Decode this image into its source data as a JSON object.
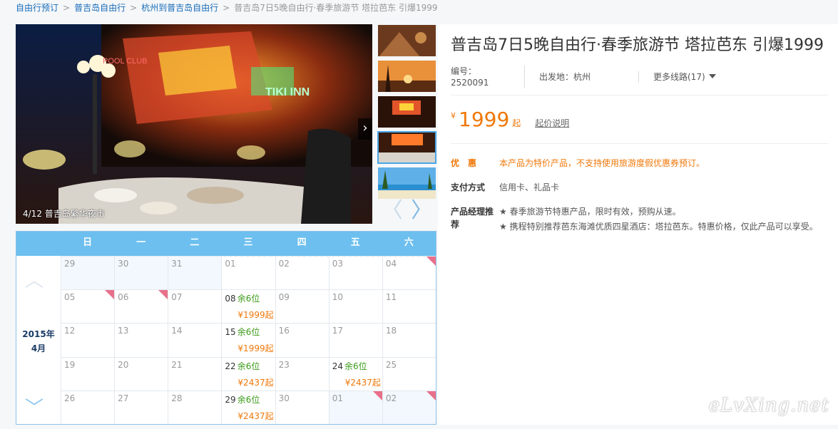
{
  "breadcrumb": {
    "items": [
      "自由行预订",
      "普吉岛自由行",
      "杭州到普吉岛自由行"
    ],
    "separator": ">",
    "current": "普吉岛7日5晚自由行·春季旅游节 塔拉芭东 引爆1999"
  },
  "gallery": {
    "caption": "4/12 普吉岛繁华夜市",
    "next_icon": "›",
    "prev_icon": "‹",
    "thumb_prev_icon": "〈",
    "thumb_next_icon": "〉",
    "photo_sign_1": "POOL CLUB",
    "photo_sign_2": "TIKI INN"
  },
  "calendar": {
    "year_month": "2015年",
    "month": "4月",
    "up_icon": "︿",
    "down_icon": "﹀",
    "weekdays": [
      "日",
      "一",
      "二",
      "三",
      "四",
      "五",
      "六"
    ],
    "cells": [
      {
        "d": "29",
        "other": true
      },
      {
        "d": "30",
        "other": true
      },
      {
        "d": "31",
        "other": true
      },
      {
        "d": "01"
      },
      {
        "d": "02"
      },
      {
        "d": "03"
      },
      {
        "d": "04",
        "flag": true
      },
      {
        "d": "05",
        "flag": true
      },
      {
        "d": "06",
        "flag": true
      },
      {
        "d": "07"
      },
      {
        "d": "08",
        "rem": "余6位",
        "price": "¥1999起"
      },
      {
        "d": "09"
      },
      {
        "d": "10"
      },
      {
        "d": "11"
      },
      {
        "d": "12"
      },
      {
        "d": "13"
      },
      {
        "d": "14"
      },
      {
        "d": "15",
        "rem": "余6位",
        "price": "¥1999起"
      },
      {
        "d": "16"
      },
      {
        "d": "17"
      },
      {
        "d": "18"
      },
      {
        "d": "19"
      },
      {
        "d": "20"
      },
      {
        "d": "21"
      },
      {
        "d": "22",
        "rem": "余6位",
        "price": "¥2437起"
      },
      {
        "d": "23"
      },
      {
        "d": "24",
        "rem": "余6位",
        "price": "¥2437起"
      },
      {
        "d": "25"
      },
      {
        "d": "26"
      },
      {
        "d": "27"
      },
      {
        "d": "28"
      },
      {
        "d": "29",
        "rem": "余6位",
        "price": "¥2437起"
      },
      {
        "d": "30"
      },
      {
        "d": "01",
        "other": true,
        "flag": true
      },
      {
        "d": "02",
        "other": true,
        "flag": true
      }
    ]
  },
  "product": {
    "title": "普吉岛7日5晚自由行·春季旅游节 塔拉芭东 引爆1999",
    "code_label": "编号：2520091",
    "departure_label": "出发地：杭州",
    "more_routes": "更多线路(17)",
    "currency": "¥",
    "price": "1999",
    "price_suffix": "起",
    "price_explain": "起价说明",
    "discount_label": "优　惠",
    "discount_text": "本产品为特价产品，不支持使用旅游度假优惠券预订。",
    "payment_label": "支付方式",
    "payment_text": "信用卡、礼品卡",
    "manager_label": "产品经理推荐",
    "recommend_1": "★ 春季旅游节特惠产品，限时有效，预购从速。",
    "recommend_2": "★ 携程特别推荐芭东海滩优质四星酒店：塔拉芭东。特惠价格，仅此产品可以享受。"
  },
  "watermark": "eLvXing.net",
  "colors": {
    "accent": "#f0780a",
    "link": "#1a6cb8",
    "calendar_header": "#6cbfee",
    "remain": "#3a9a18"
  }
}
